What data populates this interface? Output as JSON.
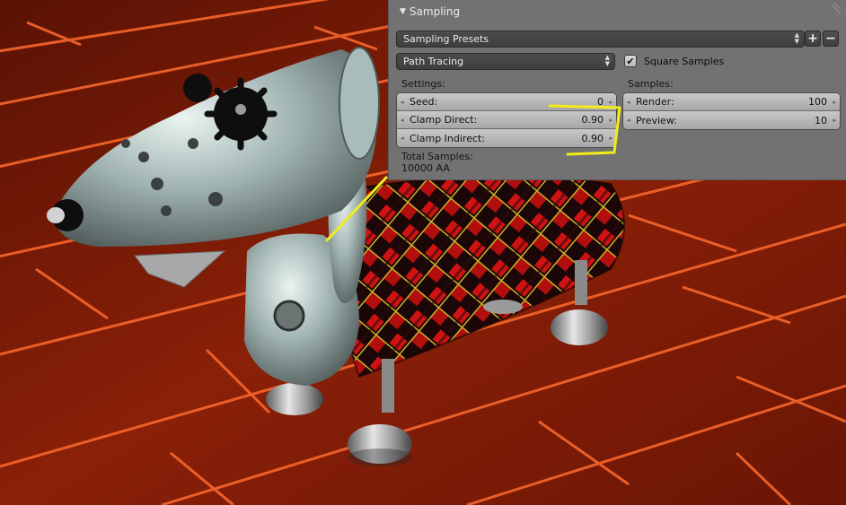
{
  "panel": {
    "title": "Sampling",
    "presets": {
      "label": "Sampling Presets",
      "add_symbol": "+",
      "remove_symbol": "−"
    },
    "integrator": {
      "value": "Path Tracing"
    },
    "square_samples": {
      "label": "Square Samples",
      "checked": true,
      "check_glyph": "✔"
    },
    "settings": {
      "heading": "Settings:",
      "fields": [
        {
          "label": "Seed:",
          "value": "0"
        },
        {
          "label": "Clamp Direct:",
          "value": "0.90"
        },
        {
          "label": "Clamp Indirect:",
          "value": "0.90"
        }
      ]
    },
    "samples": {
      "heading": "Samples:",
      "fields": [
        {
          "label": "Render:",
          "value": "100"
        },
        {
          "label": "Preview:",
          "value": "10"
        }
      ]
    },
    "total": {
      "label": "Total Samples:",
      "value": "10000 AA"
    }
  },
  "icons": {
    "collapse": "▼",
    "left_arrow": "◂",
    "right_arrow": "▸",
    "up_arrow": "▲",
    "down_arrow": "▼"
  },
  "colors": {
    "panel_bg": "#727272",
    "annotation": "#f2ec1a",
    "floor_wood": "#7a1a08",
    "floor_glow": "#ff6a2a"
  }
}
